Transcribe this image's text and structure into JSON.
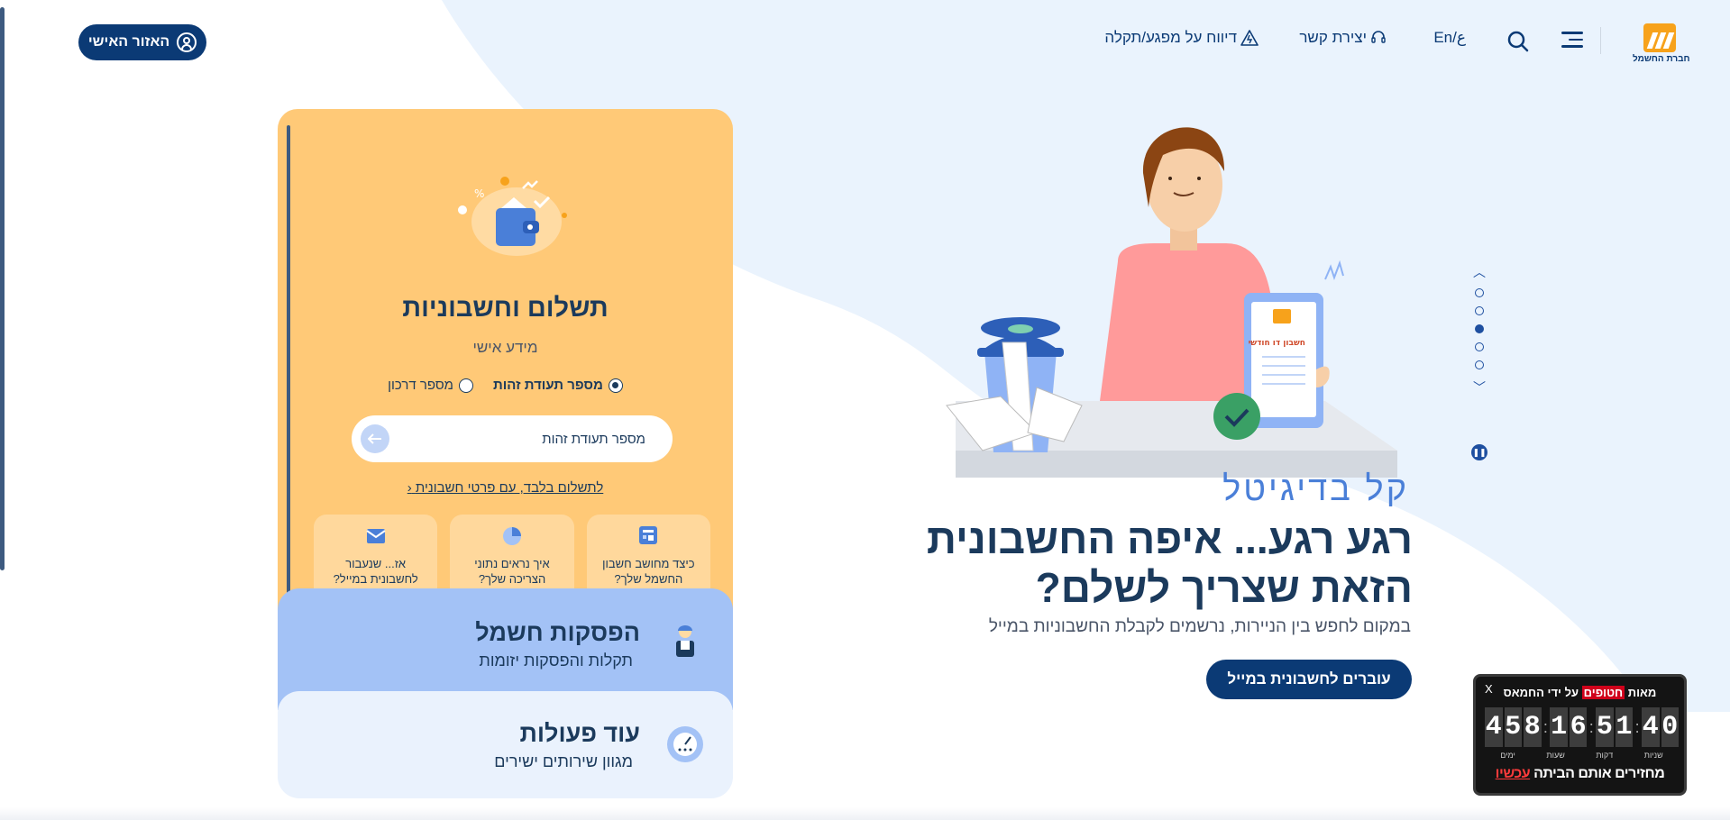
{
  "header": {
    "logo_text": "חברת החשמל",
    "nav": {
      "report_outage": "דיווח על מפגע/תקלה",
      "contact": "יצירת קשר",
      "language": "En/ع"
    },
    "personal_area": "האזור האישי"
  },
  "pay_card": {
    "title": "תשלום וחשבוניות",
    "subtitle": "מידע אישי",
    "radio_id": "מספר תעודת זהות",
    "radio_passport": "מספר דרכון",
    "id_placeholder": "מספר תעודת זהות",
    "pay_link": "לתשלום בלבד, עם פרטי חשבונית",
    "tiles": [
      {
        "line1": "כיצד מחושב חשבון",
        "line2": "החשמל שלך?"
      },
      {
        "line1": "איך נראים נתוני",
        "line2": "הצריכה שלך?"
      },
      {
        "line1": "אז... שנעבור",
        "line2": "לחשבונית במייל?"
      }
    ]
  },
  "outage_card": {
    "title": "הפסקות חשמל",
    "subtitle": "תקלות והפסקות יזומות"
  },
  "more_card": {
    "title": "עוד פעולות",
    "subtitle": "מגוון שירותים ישירים"
  },
  "hero": {
    "kicker": "קל בדיגיטל",
    "headline_line1": "רגע רגע... איפה החשבונית",
    "headline_line2": "הזאת שצריך לשלם?",
    "subtext": "במקום לחפש בין הניירות, נרשמים לקבלת החשבוניות במייל",
    "cta": "עוברים לחשבונית במייל",
    "tablet_label": "חשבון דו חודשי"
  },
  "slider": {
    "dots": 5,
    "active_index": 2
  },
  "countdown": {
    "close": "X",
    "title_pre": "מאות",
    "title_highlight": "חטופים",
    "title_post": "על ידי החמאס",
    "digits": {
      "days": [
        "4",
        "5",
        "8"
      ],
      "hours": [
        "1",
        "6"
      ],
      "minutes": [
        "5",
        "1"
      ],
      "seconds": [
        "4",
        "0"
      ]
    },
    "units": {
      "days": "ימים",
      "hours": "שעות",
      "minutes": "דקות",
      "seconds": "שניות"
    },
    "footer_pre": "מחזירים אותם הביתה",
    "footer_highlight": "עכשיו"
  },
  "colors": {
    "navy": "#0b3a75",
    "pay_card": "#ffc977",
    "outage_card": "#a3c2f6",
    "more_card": "#eaf2fd",
    "accent_blue": "#4a7fd8",
    "bg_blue": "#eaf3fd",
    "logo_orange": "#f7a21b"
  }
}
